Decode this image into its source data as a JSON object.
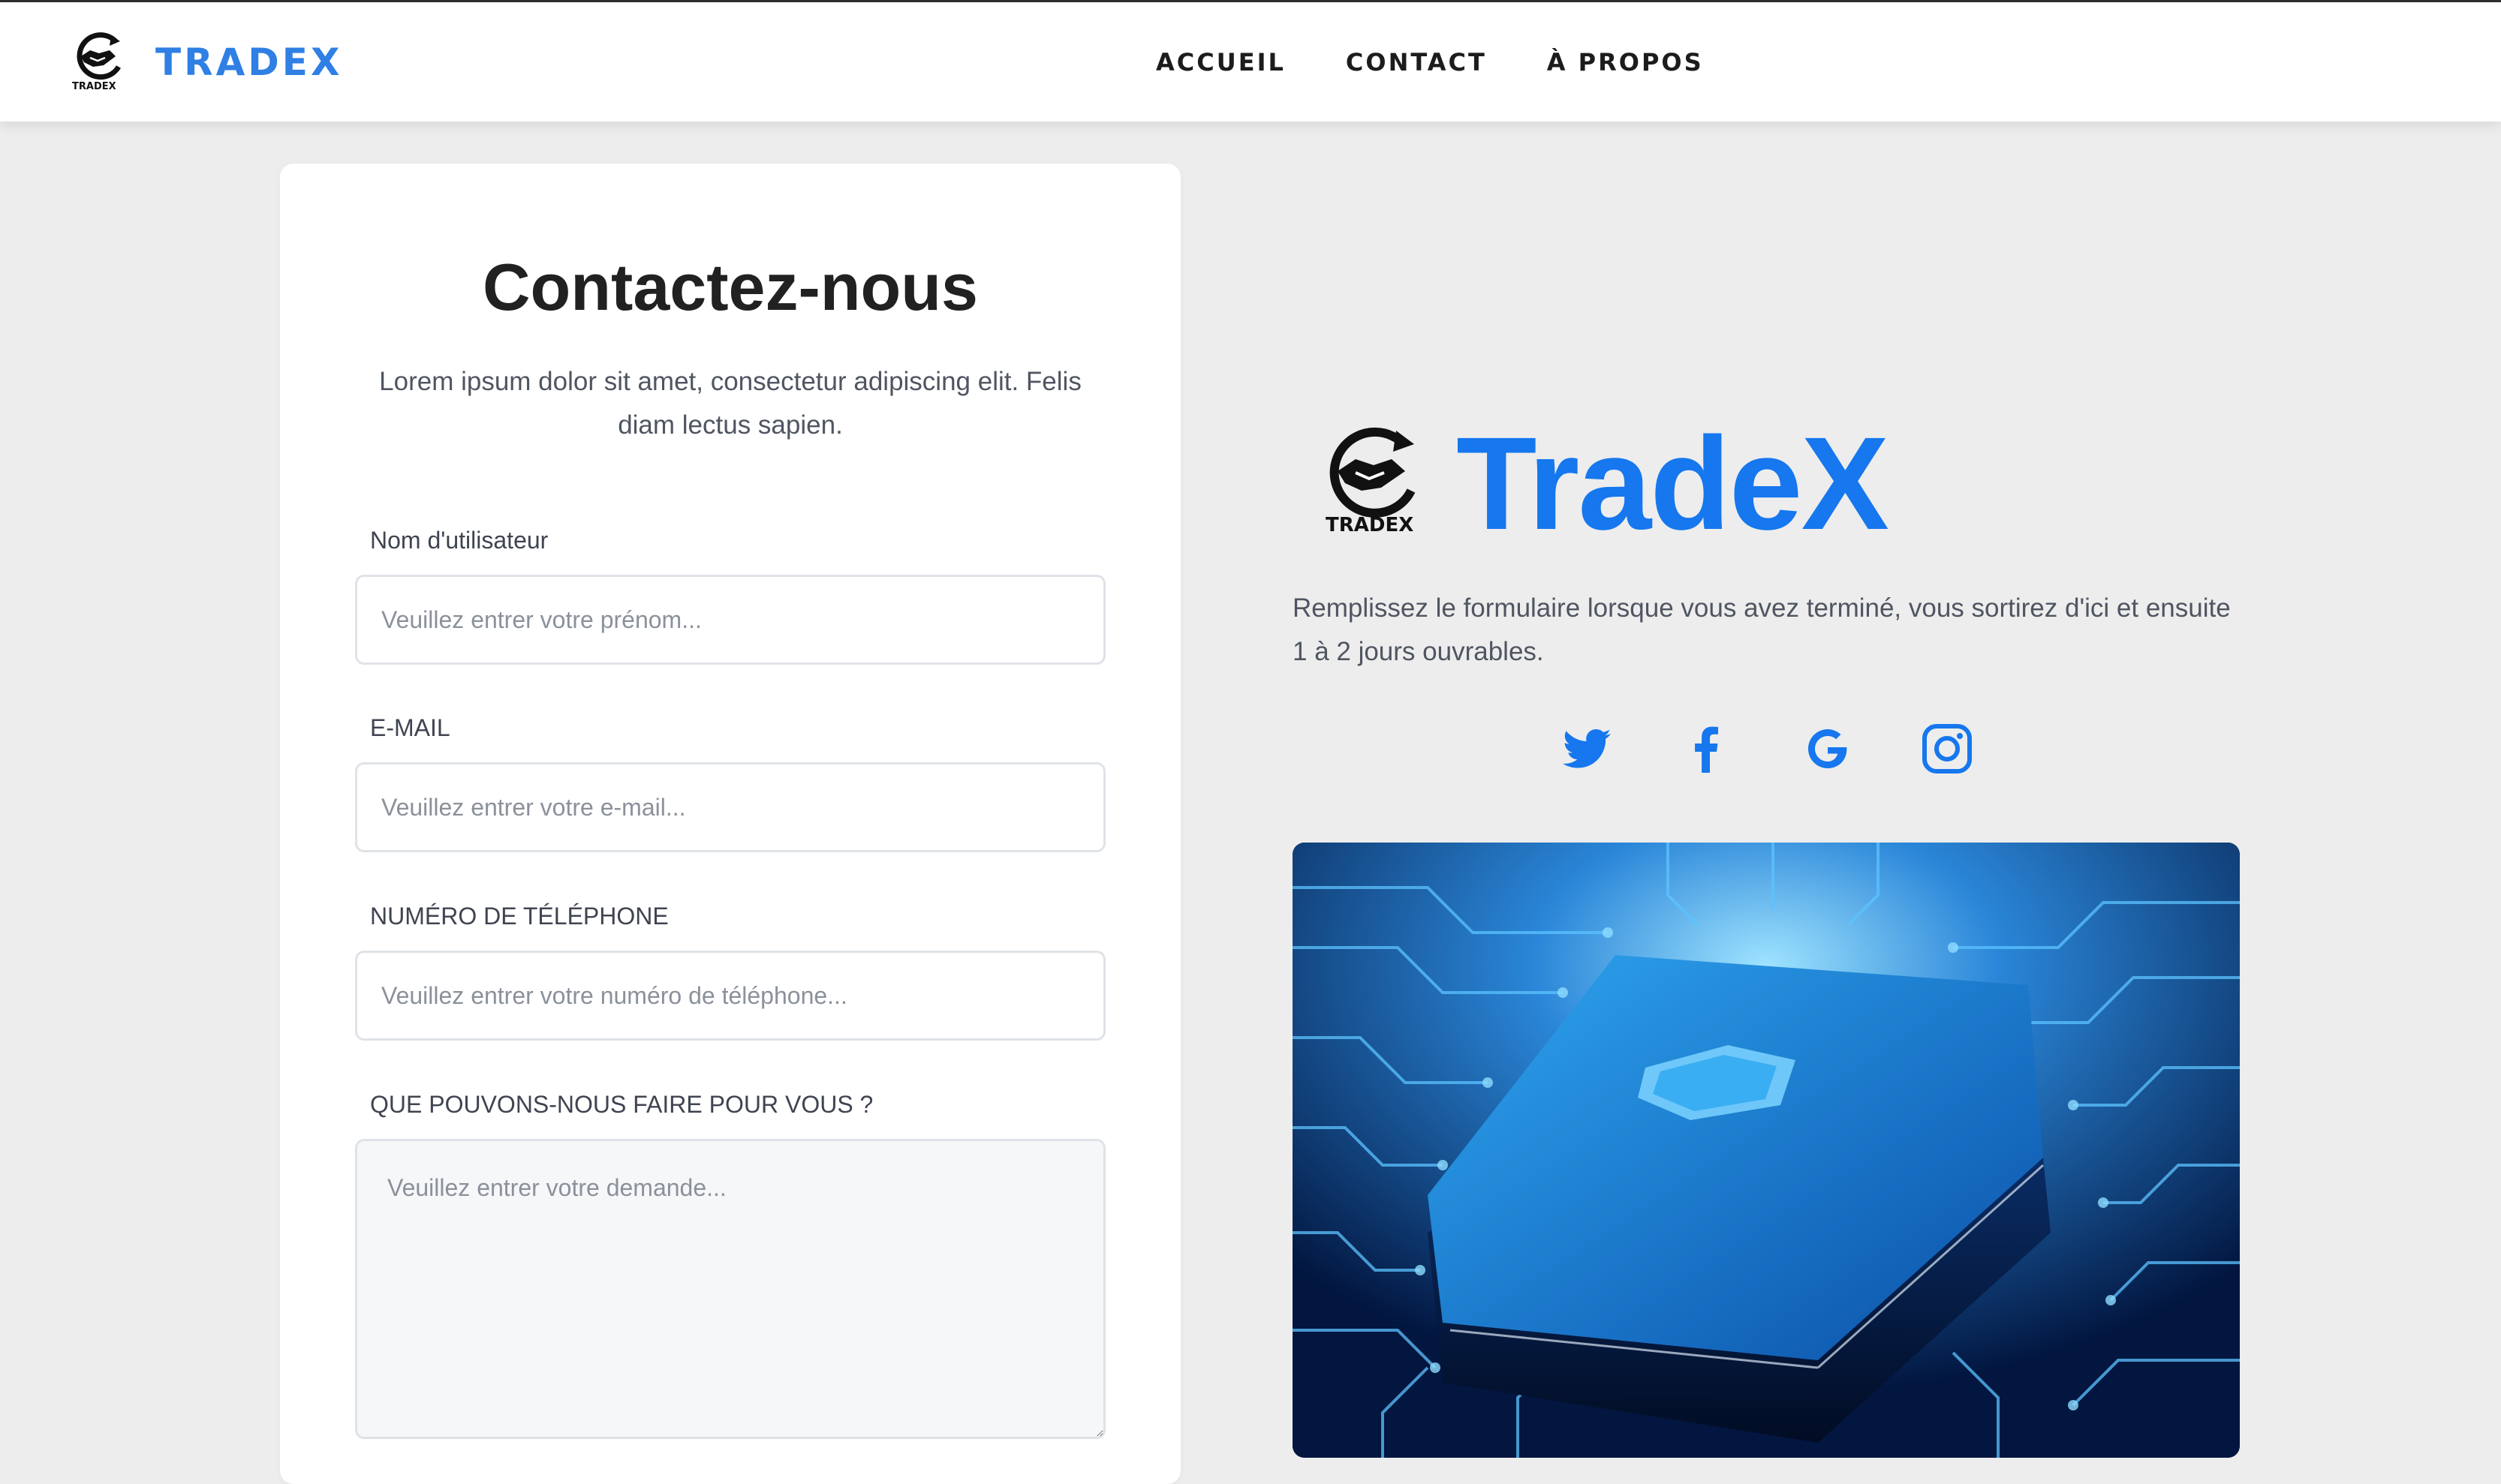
{
  "nav": {
    "brand": "TRADEX",
    "logo_caption": "TRADEX",
    "links": [
      "ACCUEIL",
      "CONTACT",
      "À PROPOS"
    ]
  },
  "form": {
    "title": "Contactez-nous",
    "subtitle": "Lorem ipsum dolor sit amet, consectetur adipiscing elit. Felis diam lectus sapien.",
    "fields": [
      {
        "label": "Nom d'utilisateur",
        "placeholder": "Veuillez entrer votre prénom..."
      },
      {
        "label": "E-MAIL",
        "placeholder": "Veuillez entrer votre e-mail..."
      },
      {
        "label": "NUMÉRO DE TÉLÉPHONE",
        "placeholder": "Veuillez entrer votre numéro de téléphone..."
      },
      {
        "label": "QUE POUVONS-NOUS FAIRE POUR VOUS ?",
        "placeholder": "Veuillez entrer votre demande..."
      }
    ]
  },
  "aside": {
    "brand": "TradeX",
    "logo_caption": "TRADEX",
    "description": "Remplissez le formulaire lorsque vous avez terminé, vous sortirez d'ici et ensuite 1 à 2 jours ouvrables.",
    "social": [
      "twitter-icon",
      "facebook-icon",
      "google-icon",
      "instagram-icon"
    ],
    "accent_color": "#1677ee",
    "hero_image": "circuit-board-chip-image"
  }
}
